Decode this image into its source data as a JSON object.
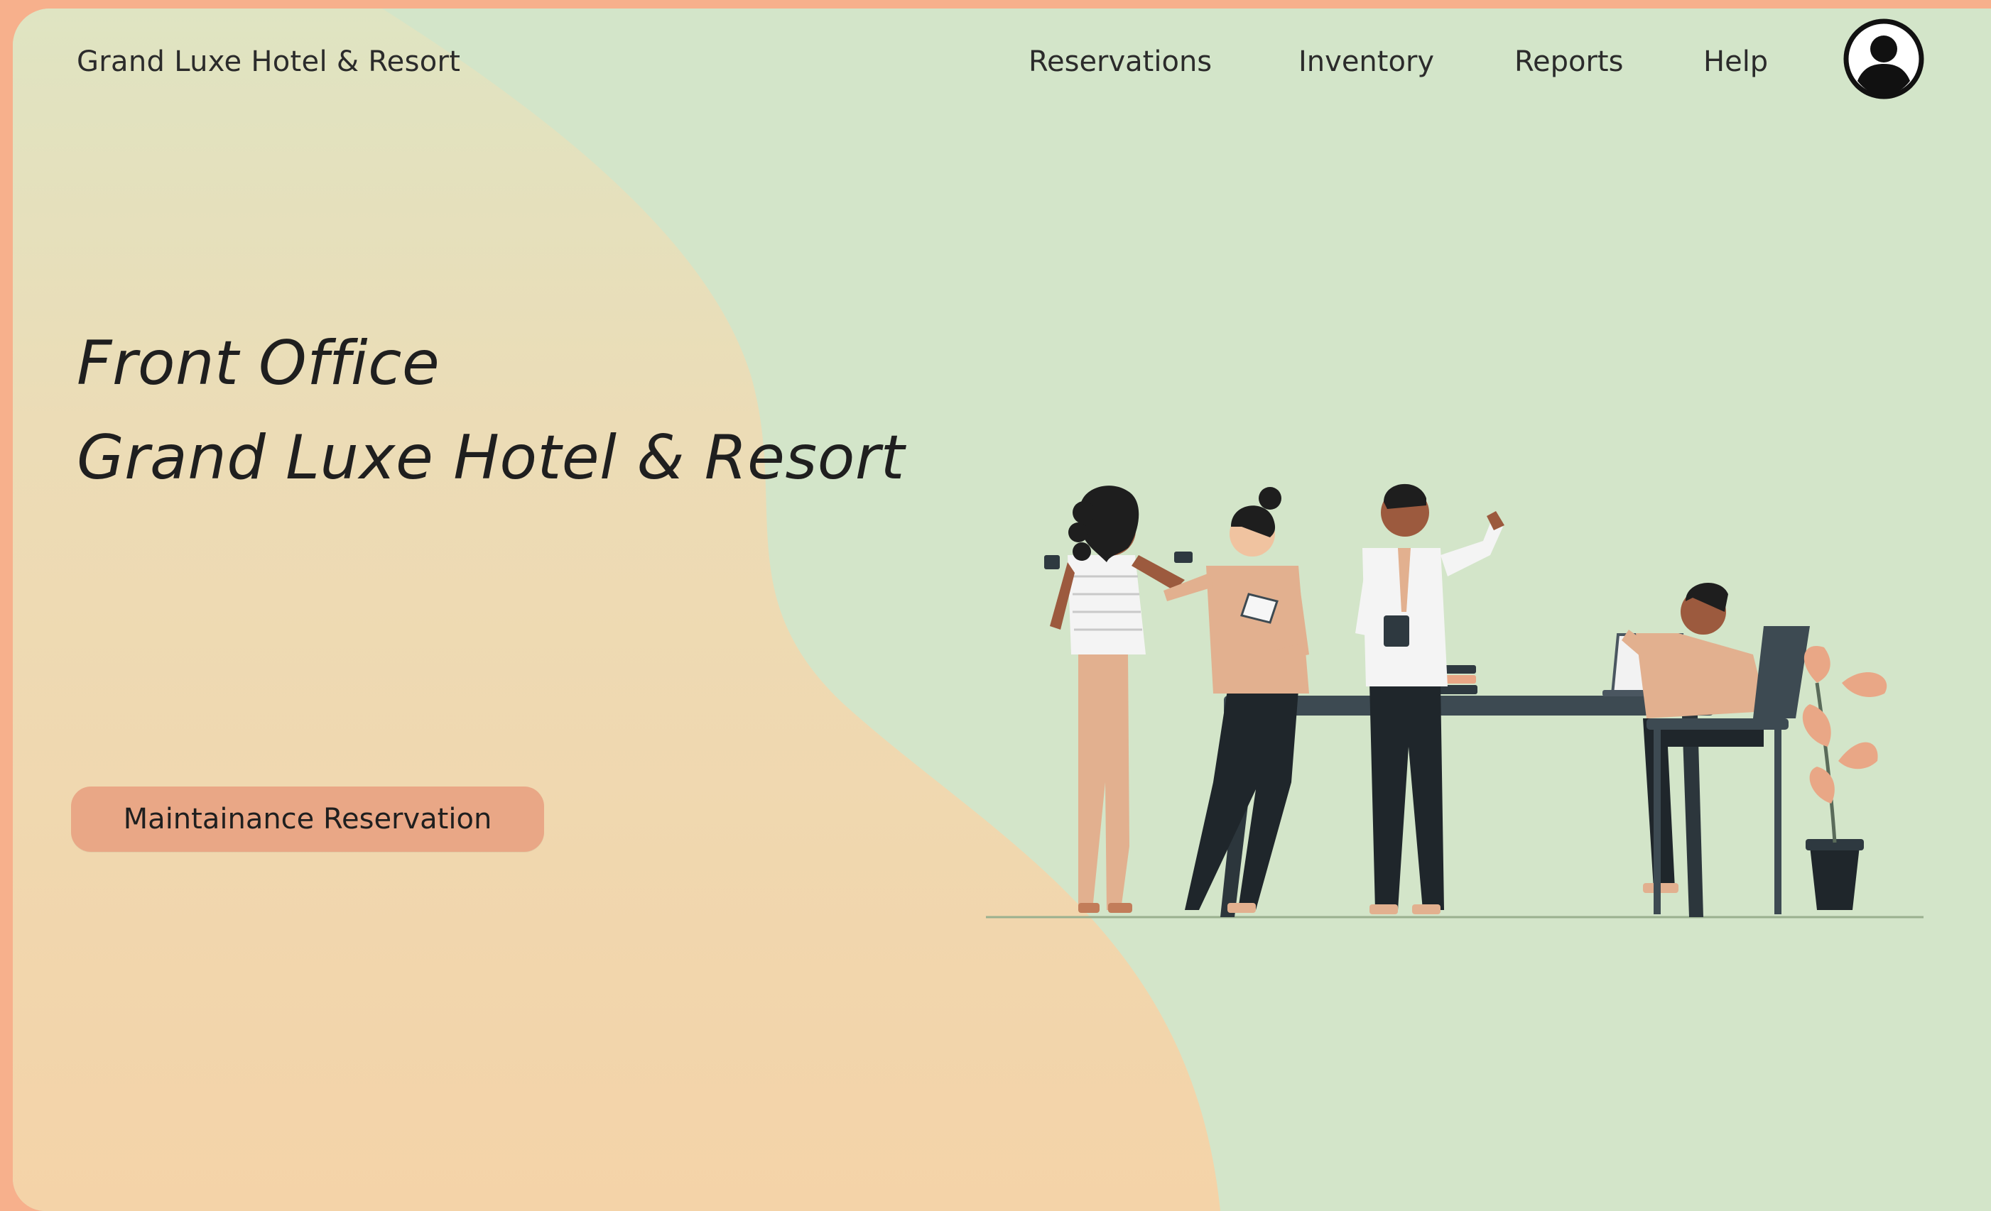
{
  "header": {
    "brand": "Grand Luxe Hotel & Resort",
    "nav": [
      "Reservations",
      "Inventory",
      "Reports",
      "Help"
    ]
  },
  "hero": {
    "line1": "Front Office",
    "line2": "Grand Luxe Hotel & Resort",
    "cta_label": "Maintainance Reservation"
  },
  "icons": {
    "profile": "user-circle-icon",
    "illustration": "team-meeting-illustration"
  },
  "colors": {
    "outer_border": "#f7b08c",
    "green_bg": "#d3e5c9",
    "peach_wave": "#f3d2a6",
    "button": "#e9a786",
    "text": "#1f1f1f"
  }
}
